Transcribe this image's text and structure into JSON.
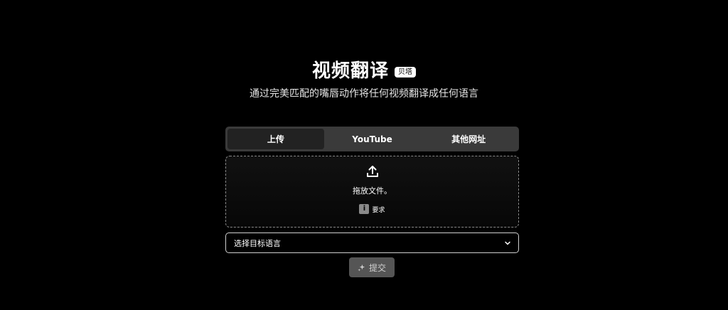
{
  "header": {
    "title": "视频翻译",
    "badge": "贝塔",
    "subtitle": "通过完美匹配的嘴唇动作将任何视频翻译成任何语言"
  },
  "tabs": [
    {
      "label": "上传",
      "active": true
    },
    {
      "label": "YouTube",
      "active": false
    },
    {
      "label": "其他网址",
      "active": false
    }
  ],
  "upload": {
    "icon": "upload-icon",
    "drop_text": "拖放文件。",
    "requirements_icon": "info-icon",
    "requirements_label": "要求"
  },
  "language_select": {
    "value": "选择目标语言",
    "icon": "chevron-down-icon"
  },
  "submit": {
    "icon": "sparkle-icon",
    "label": "提交"
  },
  "colors": {
    "background": "#000000",
    "tab_bar": "#3a3a3a",
    "tab_active": "#222222",
    "submit_bg": "#555555",
    "dashed_border": "#8a8a8a"
  }
}
